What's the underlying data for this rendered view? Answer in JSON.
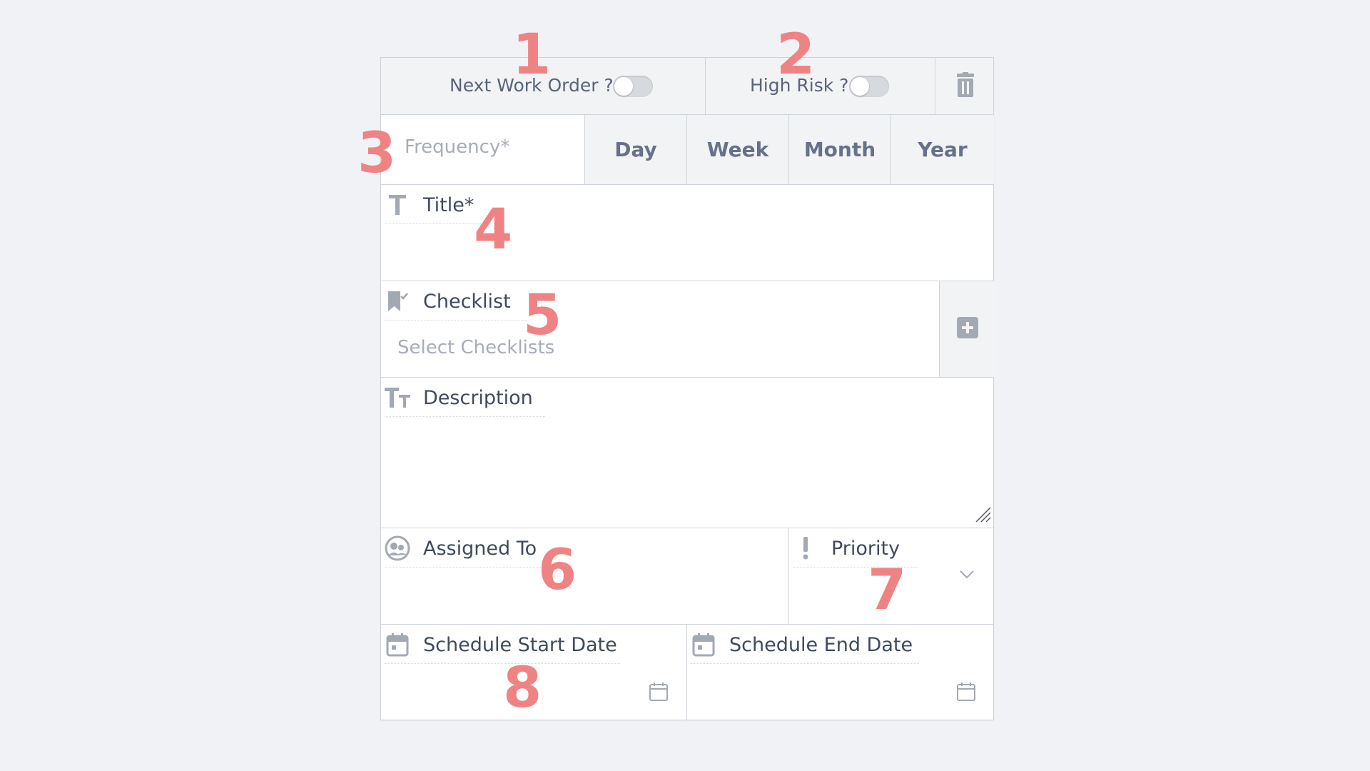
{
  "header": {
    "next_work_order_label": "Next Work Order ?",
    "high_risk_label": "High Risk ?"
  },
  "frequency": {
    "placeholder": "Frequency*",
    "options": [
      "Day",
      "Week",
      "Month",
      "Year"
    ]
  },
  "title": {
    "label": "Title*"
  },
  "checklist": {
    "label": "Checklist",
    "placeholder": "Select Checklists"
  },
  "description": {
    "label": "Description"
  },
  "assigned": {
    "label": "Assigned To"
  },
  "priority": {
    "label": "Priority"
  },
  "schedule": {
    "start_label": "Schedule Start Date",
    "end_label": "Schedule End Date"
  },
  "annotations": [
    "1",
    "2",
    "3",
    "4",
    "5",
    "6",
    "7",
    "8"
  ],
  "icons": {
    "trash": "trash-icon",
    "title": "text-t-icon",
    "checklist": "checklist-icon",
    "description": "text-size-icon",
    "assigned": "user-group-icon",
    "priority": "exclamation-icon",
    "calendar": "calendar-icon",
    "plus": "plus-icon",
    "chevron": "chevron-down-icon",
    "resize": "resize-handle-icon"
  },
  "colors": {
    "annotation": "#ef8383",
    "background": "#f1f2f5",
    "label": "#586478"
  }
}
